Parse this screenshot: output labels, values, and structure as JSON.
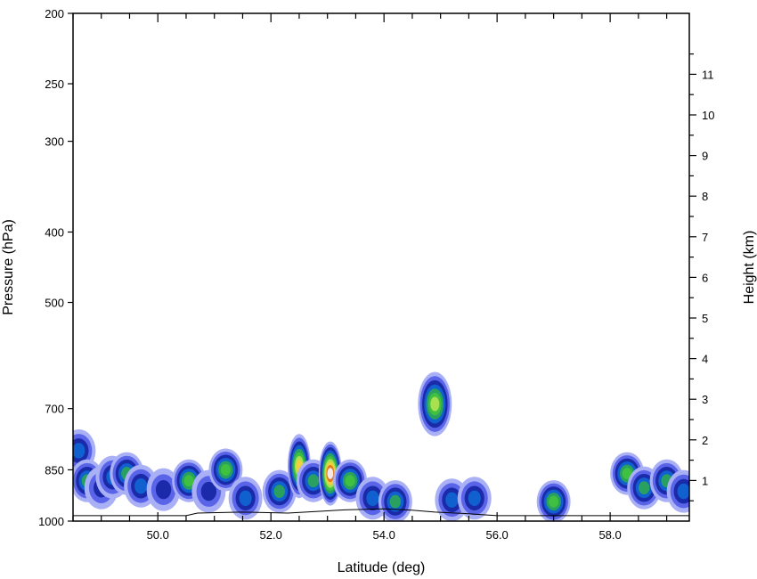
{
  "chart_data": {
    "type": "heatmap",
    "title": "",
    "xlabel": "Latitude (deg)",
    "ylabel": "Pressure (hPa)",
    "y2label": "Height (km)",
    "xlim": [
      48.5,
      59.4
    ],
    "ylim": [
      1000,
      200
    ],
    "y_scale": "log",
    "x_ticks": [
      {
        "value": 50,
        "label": "50.0"
      },
      {
        "value": 52,
        "label": "52.0"
      },
      {
        "value": 54,
        "label": "54.0"
      },
      {
        "value": 56,
        "label": "56.0"
      },
      {
        "value": 58,
        "label": "58.0"
      }
    ],
    "y_ticks": [
      {
        "value": 200,
        "label": "200"
      },
      {
        "value": 250,
        "label": "250"
      },
      {
        "value": 300,
        "label": "300"
      },
      {
        "value": 400,
        "label": "400"
      },
      {
        "value": 500,
        "label": "500"
      },
      {
        "value": 700,
        "label": "700"
      },
      {
        "value": 850,
        "label": "850"
      },
      {
        "value": 1000,
        "label": "1000"
      }
    ],
    "y2_ticks": [
      {
        "value": 1,
        "label": "1"
      },
      {
        "value": 2,
        "label": "2"
      },
      {
        "value": 3,
        "label": "3"
      },
      {
        "value": 4,
        "label": "4"
      },
      {
        "value": 5,
        "label": "5"
      },
      {
        "value": 6,
        "label": "6"
      },
      {
        "value": 7,
        "label": "7"
      },
      {
        "value": 8,
        "label": "8"
      },
      {
        "value": 9,
        "label": "9"
      },
      {
        "value": 10,
        "label": "10"
      },
      {
        "value": 11,
        "label": "11"
      }
    ],
    "palette": [
      "#aab0f5",
      "#5a64e8",
      "#1a2aa8",
      "#1060d0",
      "#2aa060",
      "#40c040",
      "#a8e050",
      "#f0d040",
      "#e07a20",
      "#f4e8e8"
    ],
    "cells": [
      {
        "lat": 48.6,
        "p": 800,
        "level": 3
      },
      {
        "lat": 48.75,
        "p": 880,
        "level": 4
      },
      {
        "lat": 49.0,
        "p": 900,
        "level": 2
      },
      {
        "lat": 49.2,
        "p": 870,
        "level": 3
      },
      {
        "lat": 49.45,
        "p": 860,
        "level": 4
      },
      {
        "lat": 49.7,
        "p": 895,
        "level": 3
      },
      {
        "lat": 50.1,
        "p": 905,
        "level": 2
      },
      {
        "lat": 50.55,
        "p": 880,
        "level": 5
      },
      {
        "lat": 50.9,
        "p": 910,
        "level": 2
      },
      {
        "lat": 51.2,
        "p": 850,
        "level": 5
      },
      {
        "lat": 51.55,
        "p": 930,
        "level": 3
      },
      {
        "lat": 52.15,
        "p": 910,
        "level": 4
      },
      {
        "lat": 52.5,
        "p": 840,
        "level": 7
      },
      {
        "lat": 52.75,
        "p": 880,
        "level": 4
      },
      {
        "lat": 53.05,
        "p": 860,
        "level": 9
      },
      {
        "lat": 53.4,
        "p": 880,
        "level": 5
      },
      {
        "lat": 53.8,
        "p": 930,
        "level": 3
      },
      {
        "lat": 54.2,
        "p": 940,
        "level": 4
      },
      {
        "lat": 54.9,
        "p": 690,
        "level": 6
      },
      {
        "lat": 55.2,
        "p": 935,
        "level": 3
      },
      {
        "lat": 55.6,
        "p": 930,
        "level": 3
      },
      {
        "lat": 57.0,
        "p": 940,
        "level": 5
      },
      {
        "lat": 58.3,
        "p": 860,
        "level": 5
      },
      {
        "lat": 58.6,
        "p": 900,
        "level": 4
      },
      {
        "lat": 59.0,
        "p": 880,
        "level": 4
      },
      {
        "lat": 59.3,
        "p": 910,
        "level": 3
      }
    ]
  }
}
